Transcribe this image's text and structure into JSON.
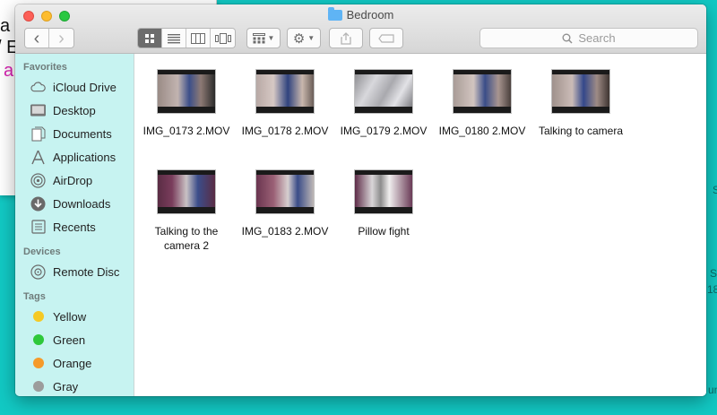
{
  "background_window": {
    "fragments": [
      "a",
      "/ E",
      "a"
    ]
  },
  "desktop_fragments": [
    "S",
    "S",
    "18",
    "S",
    "un"
  ],
  "window": {
    "title": "Bedroom"
  },
  "toolbar": {
    "back": "‹",
    "forward": "›",
    "search_placeholder": "Search"
  },
  "sidebar": {
    "favorites_header": "Favorites",
    "favorites": [
      {
        "label": "iCloud Drive",
        "icon": "cloud-icon"
      },
      {
        "label": "Desktop",
        "icon": "desktop-icon"
      },
      {
        "label": "Documents",
        "icon": "documents-icon"
      },
      {
        "label": "Applications",
        "icon": "applications-icon"
      },
      {
        "label": "AirDrop",
        "icon": "airdrop-icon"
      },
      {
        "label": "Downloads",
        "icon": "downloads-icon"
      },
      {
        "label": "Recents",
        "icon": "recents-icon"
      }
    ],
    "devices_header": "Devices",
    "devices": [
      {
        "label": "Remote Disc",
        "icon": "disc-icon"
      }
    ],
    "tags_header": "Tags",
    "tags": [
      {
        "label": "Yellow",
        "color": "#f5c924"
      },
      {
        "label": "Green",
        "color": "#2ec83a"
      },
      {
        "label": "Orange",
        "color": "#f59a2a"
      },
      {
        "label": "Gray",
        "color": "#9c9c9c"
      }
    ]
  },
  "files": [
    {
      "name": "IMG_0173 2.MOV"
    },
    {
      "name": "IMG_0178 2.MOV"
    },
    {
      "name": "IMG_0179 2.MOV"
    },
    {
      "name": "IMG_0180 2.MOV"
    },
    {
      "name": "Talking to camera"
    },
    {
      "name": "Talking to the camera 2"
    },
    {
      "name": "IMG_0183 2.MOV"
    },
    {
      "name": "Pillow fight"
    }
  ]
}
